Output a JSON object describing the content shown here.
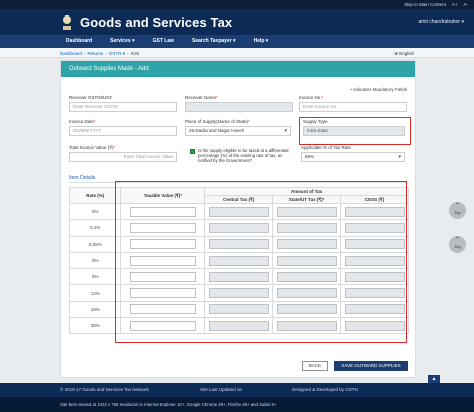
{
  "topstrip": {
    "links": [
      "Skip to Main Content",
      "A+",
      "A-"
    ]
  },
  "header": {
    "title": "Goods and Services Tax",
    "user": "amit chandrabahor ▾"
  },
  "nav": [
    {
      "label": "Dashboard"
    },
    {
      "label": "Services ▾"
    },
    {
      "label": "GST Law"
    },
    {
      "label": "Search Taxpayer ▾"
    },
    {
      "label": "Help ▾"
    }
  ],
  "breadcrumb": {
    "items": [
      "Dashboard",
      "Returns",
      "GSTR-5",
      "B2B"
    ],
    "language": "English"
  },
  "form": {
    "title": "Outward Supplies Made - Add",
    "mandatory_note": " Indicates Mandatory Fields",
    "receiver_gstin": {
      "label": "Receiver GSTIN/UIN",
      "placeholder": "Enter Receiver GSTIN"
    },
    "receiver_name": {
      "label": "Receiver Name"
    },
    "invoice_no": {
      "label": "Invoice No.",
      "placeholder": "Enter Invoice No."
    },
    "invoice_date": {
      "label": "Invoice Date",
      "placeholder": "DD/MM/YYYY"
    },
    "place_of_supply": {
      "label": "Place of Supply(Name of State)",
      "value": "26-Dadra and Nagar Haveli"
    },
    "supply_type": {
      "label": "Supply Type",
      "value": "Intra-State"
    },
    "total_invoice_value": {
      "label": "Total Invoice Value (₹)",
      "placeholder": "Enter Total Invoice Value"
    },
    "differential_text": "Is the supply eligible to be taxed at a differential percentage (%) of the existing rate of tax, as notified by the Government?",
    "applicable_pct": {
      "label": "Applicable % of Tax Rate",
      "value": "65%"
    }
  },
  "item_details": {
    "title": "Item Details",
    "headers": {
      "rate": "Rate (%)",
      "taxable": "Taxable Value (₹)",
      "amount": "Amount of Tax",
      "central": "Central Tax (₹)",
      "state": "State/UT Tax (₹)",
      "cess": "CESS (₹)"
    },
    "rates": [
      "0%",
      "0.1%",
      "0.25%",
      "3%",
      "5%",
      "12%",
      "18%",
      "28%"
    ]
  },
  "buttons": {
    "back": "BACK",
    "save": "SAVE OUTWARD SUPPLIES"
  },
  "fab": {
    "label": "Top"
  },
  "footer": {
    "copyright": "© 2016-17 Goods and Services Tax Network",
    "updated": "Site Last Updated on",
    "designed": "Designed & Developed by GSTN",
    "browser_note": "Site best viewed at 1024 x 768 resolution in Internet Explorer 10+, Google Chrome 49+, Firefox 45+ and Safari 6+"
  }
}
